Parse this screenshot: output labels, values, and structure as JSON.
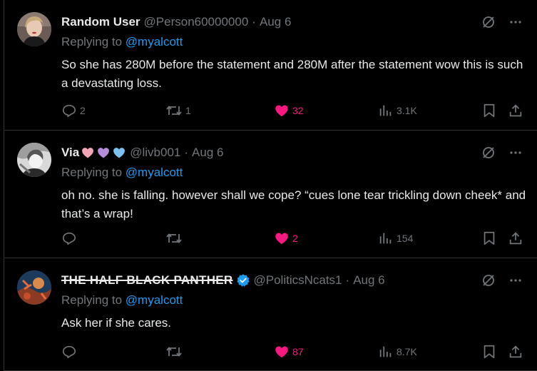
{
  "tweets": [
    {
      "name": "Random User",
      "handle": "@Person60000000",
      "separator": "·",
      "date": "Aug 6",
      "replying_prefix": "Replying to",
      "replying_to": "@myalcott",
      "text": "So she has 280M before the statement and 280M after the statement wow this is such a devastating loss.",
      "replies": "2",
      "retweets": "1",
      "likes": "32",
      "views": "3.1K",
      "liked": true
    },
    {
      "name": "Via",
      "name_emoji": [
        "pink-heart",
        "purple-heart",
        "blue-heart"
      ],
      "handle": "@livb001",
      "separator": "·",
      "date": "Aug 6",
      "replying_prefix": "Replying to",
      "replying_to": "@myalcott",
      "text": "oh no. she is falling. however shall we cope? “cues lone tear trickling down cheek* and that’s a wrap!",
      "replies": "",
      "retweets": "",
      "likes": "2",
      "views": "154",
      "liked": true
    },
    {
      "name": "THE HALF BLACK PANTHER",
      "verified": true,
      "handle": "@PoliticsNcats1",
      "separator": "·",
      "date": "Aug 6",
      "replying_prefix": "Replying to",
      "replying_to": "@myalcott",
      "text": "Ask her if she cares.",
      "replies": "",
      "retweets": "",
      "likes": "87",
      "views": "8.7K",
      "liked": true
    }
  ],
  "colors": {
    "background": "#000000",
    "text": "#e7e9ea",
    "muted": "#71767b",
    "link": "#1d9bf0",
    "like": "#f91880",
    "border": "#2f3336"
  }
}
